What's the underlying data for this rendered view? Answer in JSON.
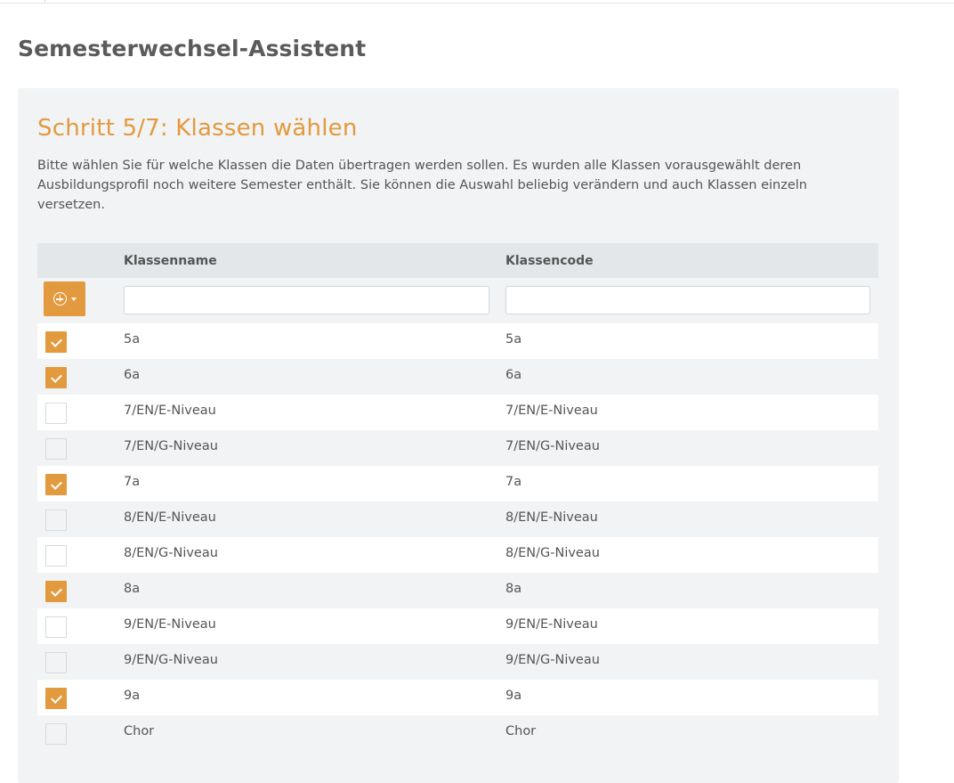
{
  "page": {
    "title": "Semesterwechsel-Assistent"
  },
  "step": {
    "title": "Schritt 5/7: Klassen wählen",
    "description": "Bitte wählen Sie für welche Klassen die Daten übertragen werden sollen. Es wurden alle Klassen vorausgewählt deren Ausbildungsprofil noch weitere Semester enthält. Sie können die Auswahl beliebig verändern und auch Klassen einzeln versetzen."
  },
  "table": {
    "columns": {
      "name": "Klassenname",
      "code": "Klassencode"
    },
    "filters": {
      "name_value": "",
      "code_value": ""
    },
    "add_button_icon": "plus-circle-icon",
    "rows": [
      {
        "name": "5a",
        "code": "5a",
        "checked": true
      },
      {
        "name": "6a",
        "code": "6a",
        "checked": true
      },
      {
        "name": "7/EN/E-Niveau",
        "code": "7/EN/E-Niveau",
        "checked": false
      },
      {
        "name": "7/EN/G-Niveau",
        "code": "7/EN/G-Niveau",
        "checked": false
      },
      {
        "name": "7a",
        "code": "7a",
        "checked": true
      },
      {
        "name": "8/EN/E-Niveau",
        "code": "8/EN/E-Niveau",
        "checked": false
      },
      {
        "name": "8/EN/G-Niveau",
        "code": "8/EN/G-Niveau",
        "checked": false
      },
      {
        "name": "8a",
        "code": "8a",
        "checked": true
      },
      {
        "name": "9/EN/E-Niveau",
        "code": "9/EN/E-Niveau",
        "checked": false
      },
      {
        "name": "9/EN/G-Niveau",
        "code": "9/EN/G-Niveau",
        "checked": false
      },
      {
        "name": "9a",
        "code": "9a",
        "checked": true
      },
      {
        "name": "Chor",
        "code": "Chor",
        "checked": false
      }
    ]
  },
  "colors": {
    "accent": "#e39a3e",
    "panel": "#f1f3f4",
    "header": "#e4e7e9"
  }
}
